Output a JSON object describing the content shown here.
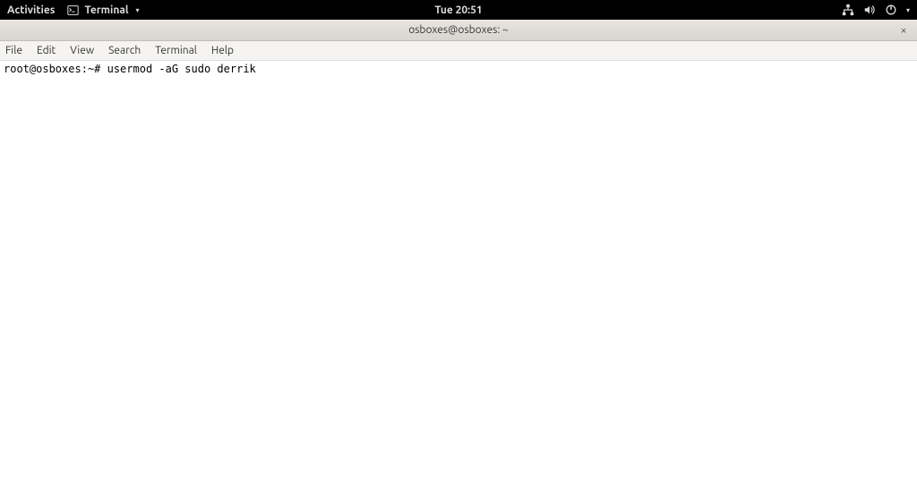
{
  "topbar": {
    "activities": "Activities",
    "app_name": "Terminal",
    "clock": "Tue 20:51"
  },
  "window": {
    "title": "osboxes@osboxes: ~",
    "close_symbol": "×"
  },
  "menubar": {
    "items": [
      "File",
      "Edit",
      "View",
      "Search",
      "Terminal",
      "Help"
    ]
  },
  "terminal": {
    "prompt": "root@osboxes:~#",
    "command": "usermod -aG sudo derrik"
  }
}
